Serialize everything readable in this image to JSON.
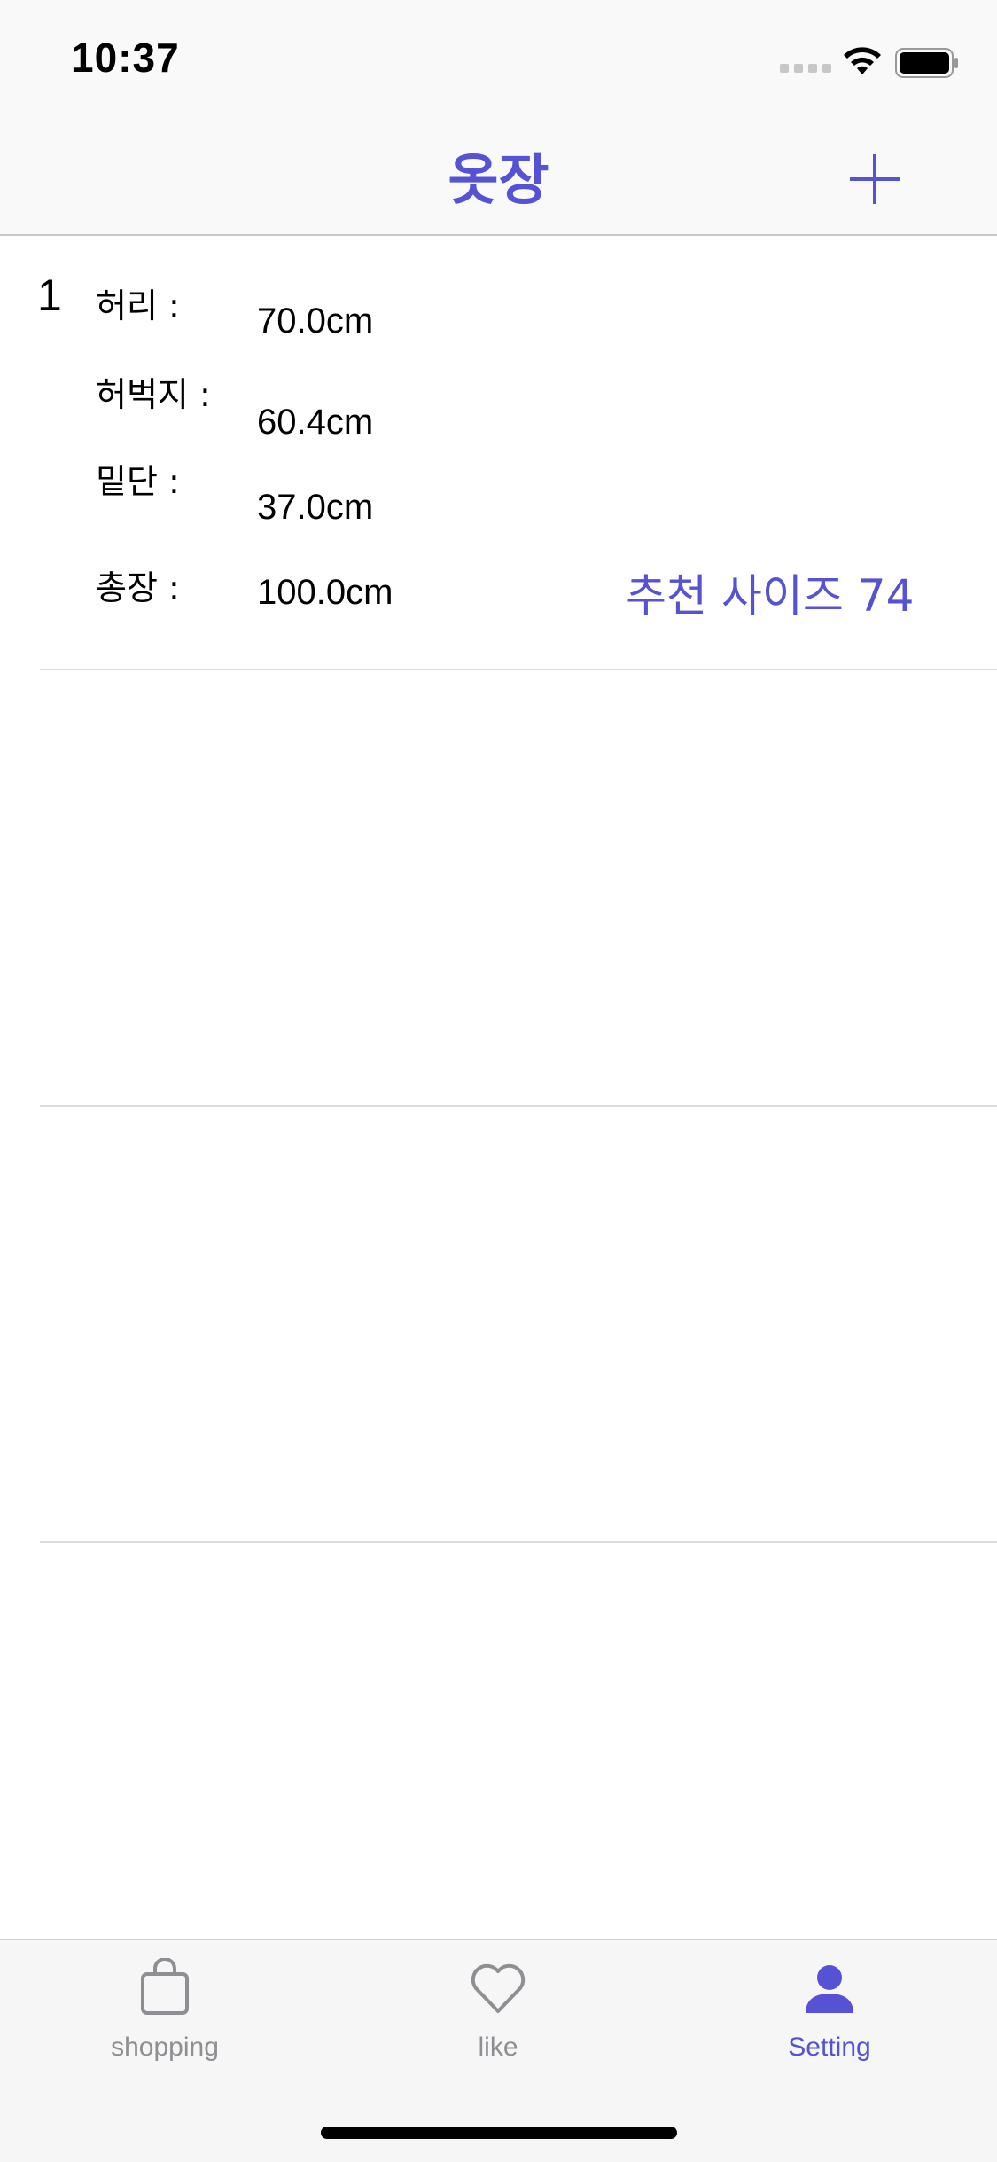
{
  "status_bar": {
    "time": "10:37"
  },
  "nav": {
    "title": "옷장",
    "add_icon": "plus-icon"
  },
  "items": [
    {
      "index": "1",
      "waist_label": "허리 :",
      "waist_value": "70.0cm",
      "thigh_label": "허벅지 :",
      "thigh_value": "60.4cm",
      "hem_label": "밑단 :",
      "hem_value": "37.0cm",
      "length_label": "총장 :",
      "length_value": "100.0cm",
      "recommend": "추천 사이즈 74"
    }
  ],
  "tabs": [
    {
      "label": "shopping",
      "icon": "shopping-bag-icon",
      "active": false
    },
    {
      "label": "like",
      "icon": "heart-icon",
      "active": false
    },
    {
      "label": "Setting",
      "icon": "person-icon",
      "active": true
    }
  ],
  "colors": {
    "accent": "#5552d4",
    "inactive": "#8e8e93"
  }
}
